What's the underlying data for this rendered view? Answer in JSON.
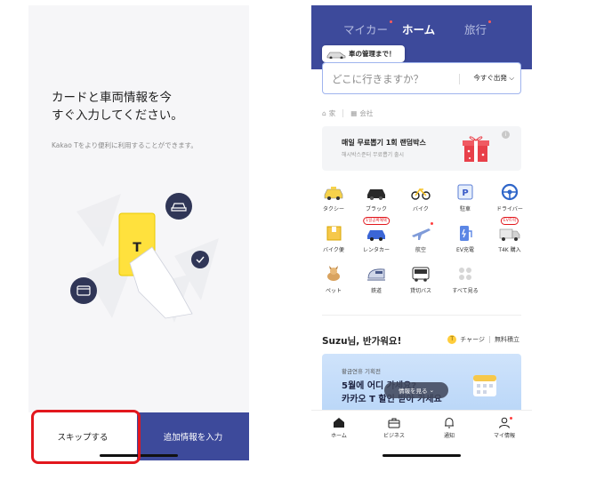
{
  "left_screen": {
    "headline": "カードと車両情報を今\nすぐ入力してください。",
    "subtext": "Kakao Tをより便利に利用することができます。",
    "skip_label": "スキップする",
    "add_info_label": "追加情報を入力",
    "phone_icon_text": "T"
  },
  "right_screen": {
    "tabs": [
      {
        "label": "マイカー",
        "active": false,
        "dot": true
      },
      {
        "label": "ホーム",
        "active": true,
        "dot": false
      },
      {
        "label": "旅行",
        "active": false,
        "dot": true
      }
    ],
    "tooltip": "車の管理まで！",
    "search": {
      "placeholder": "どこに行きますか？",
      "depart_label": "今すぐ出発"
    },
    "favorites": [
      {
        "label": "家",
        "icon": "home-icon"
      },
      {
        "label": "会社",
        "icon": "building-icon"
      }
    ],
    "banner": {
      "title": "매일 무료뽑기 1회 랜덤박스",
      "subtitle": "해시박스준터 무료뽑기 출시",
      "info": "i"
    },
    "services": [
      {
        "label": "タクシー",
        "icon": "taxi-icon",
        "badge": "",
        "dot": false
      },
      {
        "label": "ブラック",
        "icon": "black-car-icon",
        "badge": "",
        "dot": false
      },
      {
        "label": "バイク",
        "icon": "bike-icon",
        "badge": "",
        "dot": false
      },
      {
        "label": "駐車",
        "icon": "parking-icon",
        "badge": "",
        "dot": false
      },
      {
        "label": "ドライバー",
        "icon": "steering-wheel-icon",
        "badge": "",
        "dot": false
      },
      {
        "label": "バイク便",
        "icon": "box-icon",
        "badge": "",
        "dot": false
      },
      {
        "label": "レンタカー",
        "icon": "rental-car-icon",
        "badge": "1일공짜혜택",
        "dot": false
      },
      {
        "label": "航空",
        "icon": "airplane-icon",
        "badge": "",
        "dot": true
      },
      {
        "label": "EV充電",
        "icon": "ev-charger-icon",
        "badge": "",
        "dot": false
      },
      {
        "label": "T4K 購入",
        "icon": "truck-icon",
        "badge": "EV트럭",
        "dot": false
      },
      {
        "label": "ペット",
        "icon": "pet-icon",
        "badge": "",
        "dot": false
      },
      {
        "label": "鉄道",
        "icon": "train-icon",
        "badge": "",
        "dot": false
      },
      {
        "label": "貸切バス",
        "icon": "bus-icon",
        "badge": "",
        "dot": false
      },
      {
        "label": "すべて見る",
        "icon": "more-dots-icon",
        "badge": "",
        "dot": false
      }
    ],
    "greeting": "Suzu님, 반가워요!",
    "charge_label": "チャージ",
    "free_label": "無料積立",
    "promo": {
      "line1": "황금연휴 기획전",
      "line2": "5월에 어디 가세요?",
      "line3": "카카오 T 할인 받아 가세요"
    },
    "info_pill": "情報を見る",
    "nav": [
      {
        "label": "ホーム",
        "icon": "home-icon"
      },
      {
        "label": "ビジネス",
        "icon": "briefcase-icon"
      },
      {
        "label": "通知",
        "icon": "bell-icon"
      },
      {
        "label": "マイ情報",
        "icon": "person-icon"
      }
    ]
  },
  "colors": {
    "brand_blue": "#3d4a9b",
    "highlight_red": "#e2171d",
    "kakao_yellow": "#ffe13d"
  }
}
